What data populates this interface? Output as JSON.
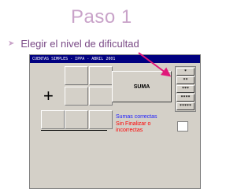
{
  "slide": {
    "title": "Paso 1",
    "bullet": "Elegir el nivel de dificultad"
  },
  "app": {
    "title": "CUENTAS SIMPLES - IPPA - ABRIL 2001",
    "operation_symbol": "+",
    "suma_button": "SUMA",
    "levels": [
      "*",
      "**",
      "***",
      "****",
      "*****"
    ],
    "sumas_correctas": "Sumas correctas",
    "sin_finalizar": "Sin Finalizar o incorrectas"
  },
  "colors": {
    "title": "#c9a3c9",
    "bullet_text": "#7a4a86",
    "window_bg": "#d4d0c8",
    "titlebar": "#000080",
    "sumas_text": "#1a1aff",
    "sinfin_text": "#ff0000",
    "arrow": "#e0187a"
  }
}
